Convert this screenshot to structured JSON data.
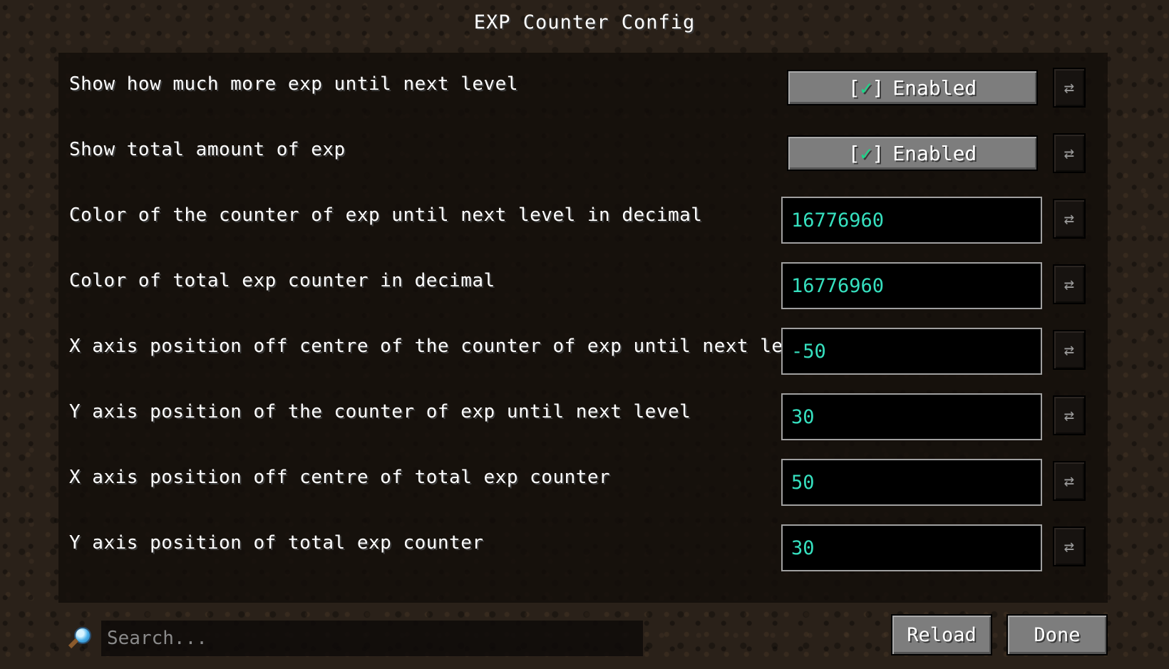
{
  "screen": {
    "title": "EXP Counter Config"
  },
  "colors": {
    "check_mark": "#19d98a",
    "field_text": "#36e0bf",
    "button_face": "#7d7d7d"
  },
  "options": [
    {
      "label": "Show how much more exp until next level",
      "type": "toggle",
      "value": "Enabled"
    },
    {
      "label": "Show total amount of exp",
      "type": "toggle",
      "value": "Enabled"
    },
    {
      "label": "Color of the counter of exp until next level in decimal",
      "type": "number",
      "value": "16776960"
    },
    {
      "label": "Color of total exp counter in decimal",
      "type": "number",
      "value": "16776960"
    },
    {
      "label": "X axis position off centre of the counter of exp until next level",
      "type": "number",
      "value": "-50"
    },
    {
      "label": "Y axis position of the counter of exp until next level",
      "type": "number",
      "value": "30"
    },
    {
      "label": "X axis position off centre of total exp counter",
      "type": "number",
      "value": "50"
    },
    {
      "label": "Y axis position of total exp counter",
      "type": "number",
      "value": "30"
    }
  ],
  "toggle": {
    "check_open": "[",
    "check_mark": "✓",
    "check_close": "]"
  },
  "reset_icon": "⇄",
  "icons": {
    "reset": "swap-arrows-icon",
    "search": "magnifying-glass-icon"
  },
  "search": {
    "placeholder": "Search..."
  },
  "footer": {
    "reload_label": "Reload",
    "done_label": "Done"
  }
}
